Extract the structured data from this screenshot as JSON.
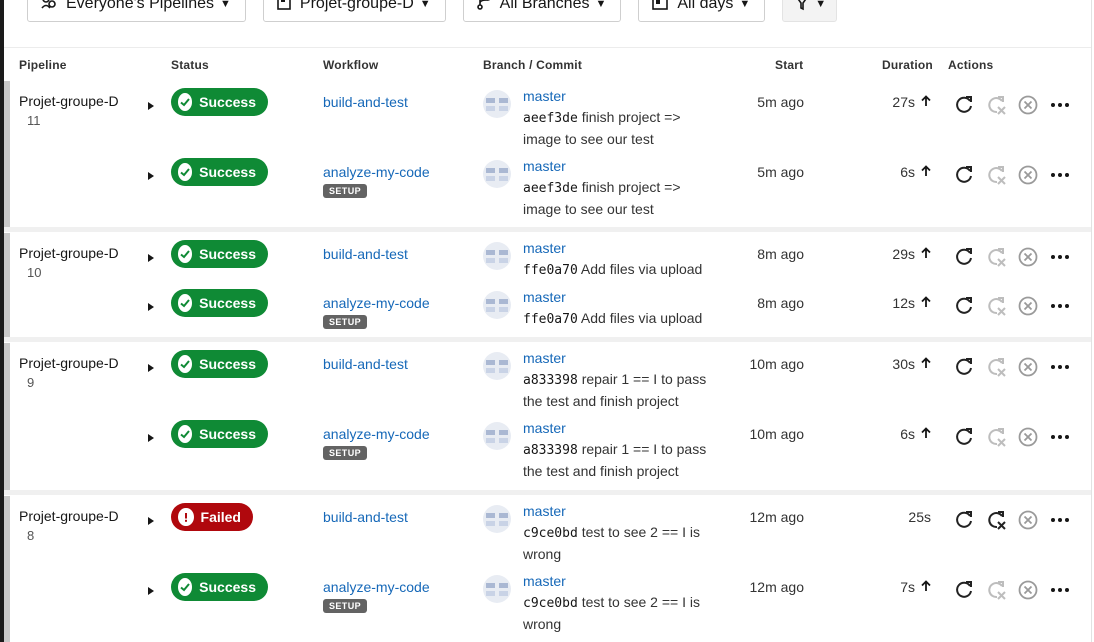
{
  "filters": [
    {
      "label": "Everyone's Pipelines",
      "icon": "users-icon"
    },
    {
      "label": "Projet-groupe-D",
      "icon": "project-icon"
    },
    {
      "label": "All Branches",
      "icon": "branch-icon"
    },
    {
      "label": "All days",
      "icon": "calendar-icon"
    },
    {
      "label": "",
      "icon": "filter-icon"
    }
  ],
  "headers": {
    "pipeline": "Pipeline",
    "status": "Status",
    "workflow": "Workflow",
    "branch_commit": "Branch / Commit",
    "start": "Start",
    "duration": "Duration",
    "actions": "Actions"
  },
  "groups": [
    {
      "pipeline": "Projet-groupe-D",
      "number": "11",
      "rows": [
        {
          "status": "Success",
          "workflow": "build-and-test",
          "setup": "",
          "branch": "master",
          "sha": "aeef3de",
          "message_lines": [
            "finish project =>",
            "image to see our test"
          ],
          "start": "5m ago",
          "duration": "27s",
          "arrow": true
        },
        {
          "status": "Success",
          "workflow": "analyze-my-code",
          "setup": "SETUP",
          "branch": "master",
          "sha": "aeef3de",
          "message_lines": [
            "finish project =>",
            "image to see our test"
          ],
          "start": "5m ago",
          "duration": "6s",
          "arrow": true
        }
      ]
    },
    {
      "pipeline": "Projet-groupe-D",
      "number": "10",
      "rows": [
        {
          "status": "Success",
          "workflow": "build-and-test",
          "setup": "",
          "branch": "master",
          "sha": "ffe0a70",
          "message_lines": [
            "Add files via upload"
          ],
          "start": "8m ago",
          "duration": "29s",
          "arrow": true
        },
        {
          "status": "Success",
          "workflow": "analyze-my-code",
          "setup": "SETUP",
          "branch": "master",
          "sha": "ffe0a70",
          "message_lines": [
            "Add files via upload"
          ],
          "start": "8m ago",
          "duration": "12s",
          "arrow": true
        }
      ]
    },
    {
      "pipeline": "Projet-groupe-D",
      "number": "9",
      "rows": [
        {
          "status": "Success",
          "workflow": "build-and-test",
          "setup": "",
          "branch": "master",
          "sha": "a833398",
          "message_lines": [
            "repair 1 == I to pass",
            "the test and finish project"
          ],
          "start": "10m ago",
          "duration": "30s",
          "arrow": true
        },
        {
          "status": "Success",
          "workflow": "analyze-my-code",
          "setup": "SETUP",
          "branch": "master",
          "sha": "a833398",
          "message_lines": [
            "repair 1 == I to pass",
            "the test and finish project"
          ],
          "start": "10m ago",
          "duration": "6s",
          "arrow": true
        }
      ]
    },
    {
      "pipeline": "Projet-groupe-D",
      "number": "8",
      "rows": [
        {
          "status": "Failed",
          "workflow": "build-and-test",
          "setup": "",
          "branch": "master",
          "sha": "c9ce0bd",
          "message_lines": [
            "test to see 2 == I is",
            "wrong"
          ],
          "start": "12m ago",
          "duration": "25s",
          "arrow": false
        },
        {
          "status": "Success",
          "workflow": "analyze-my-code",
          "setup": "SETUP",
          "branch": "master",
          "sha": "c9ce0bd",
          "message_lines": [
            "test to see 2 == I is",
            "wrong"
          ],
          "start": "12m ago",
          "duration": "7s",
          "arrow": true
        }
      ]
    }
  ],
  "colors": {
    "success": "#0f8a35",
    "failed": "#b0080d",
    "link": "#1668b8"
  }
}
